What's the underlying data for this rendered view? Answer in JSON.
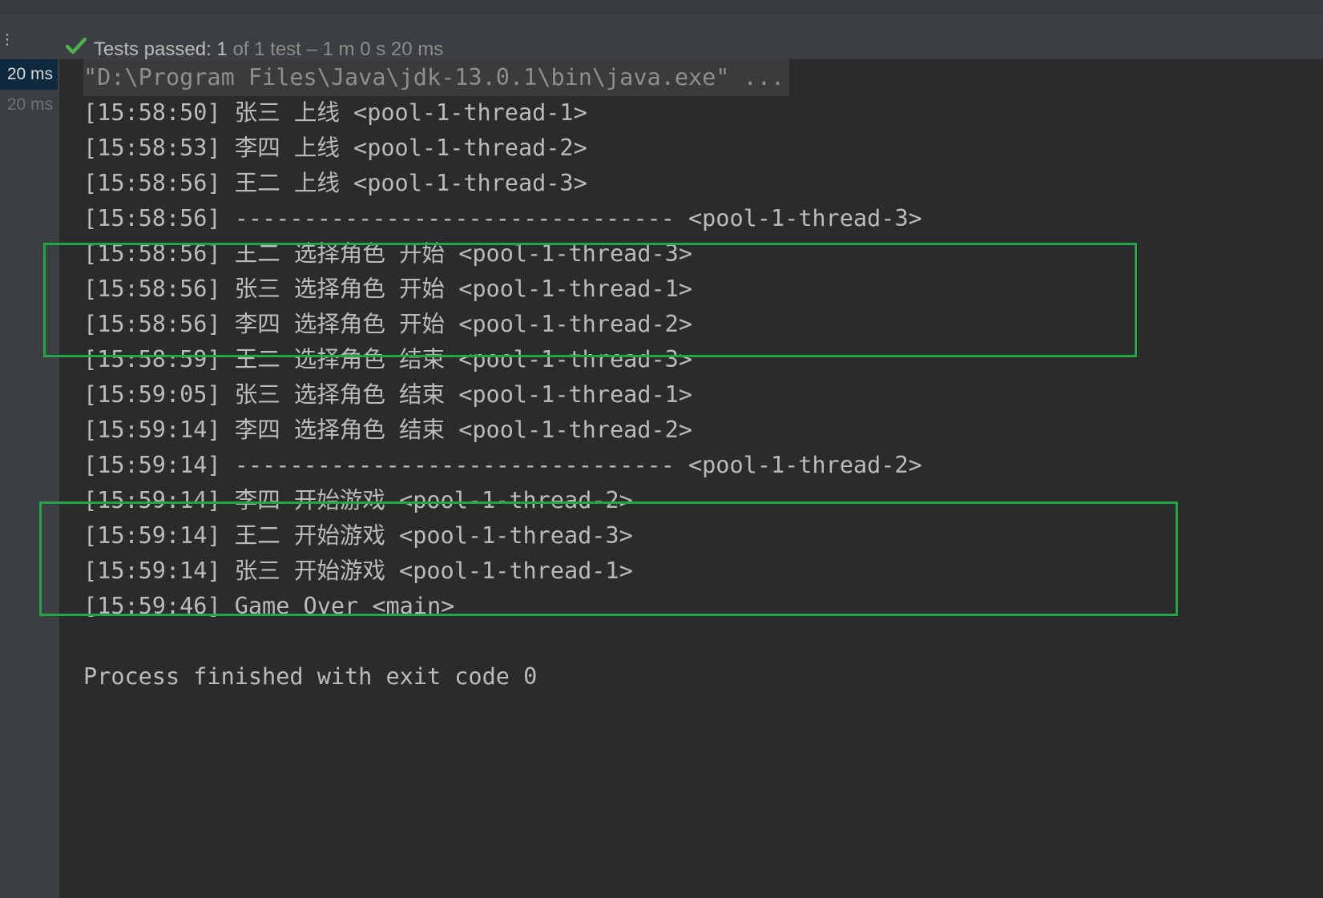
{
  "toolbar": {
    "handle_icon": "drag-handle-icon",
    "status_icon": "check-icon",
    "status_color": "#4fb04f",
    "status_label": "Tests passed: ",
    "status_count": "1",
    "status_rest": " of 1 test – 1 m 0 s 20 ms"
  },
  "gutter": {
    "rows": [
      {
        "label": "20 ms",
        "selected": true
      },
      {
        "label": "20 ms",
        "selected": false
      }
    ]
  },
  "console": {
    "command": "\"D:\\Program Files\\Java\\jdk-13.0.1\\bin\\java.exe\" ...",
    "lines": [
      "[15:58:50] 张三 上线 <pool-1-thread-1>",
      "[15:58:53] 李四 上线 <pool-1-thread-2>",
      "[15:58:56] 王二 上线 <pool-1-thread-3>",
      "[15:58:56] -------------------------------- <pool-1-thread-3>",
      "[15:58:56] 王二 选择角色 开始 <pool-1-thread-3>",
      "[15:58:56] 张三 选择角色 开始 <pool-1-thread-1>",
      "[15:58:56] 李四 选择角色 开始 <pool-1-thread-2>",
      "[15:58:59] 王二 选择角色 结束 <pool-1-thread-3>",
      "[15:59:05] 张三 选择角色 结束 <pool-1-thread-1>",
      "[15:59:14] 李四 选择角色 结束 <pool-1-thread-2>",
      "[15:59:14] -------------------------------- <pool-1-thread-2>",
      "[15:59:14] 李四 开始游戏 <pool-1-thread-2>",
      "[15:59:14] 王二 开始游戏 <pool-1-thread-3>",
      "[15:59:14] 张三 开始游戏 <pool-1-thread-1>",
      "[15:59:46] Game Over <main>",
      "",
      "Process finished with exit code 0"
    ],
    "highlight_color": "#21a548"
  }
}
